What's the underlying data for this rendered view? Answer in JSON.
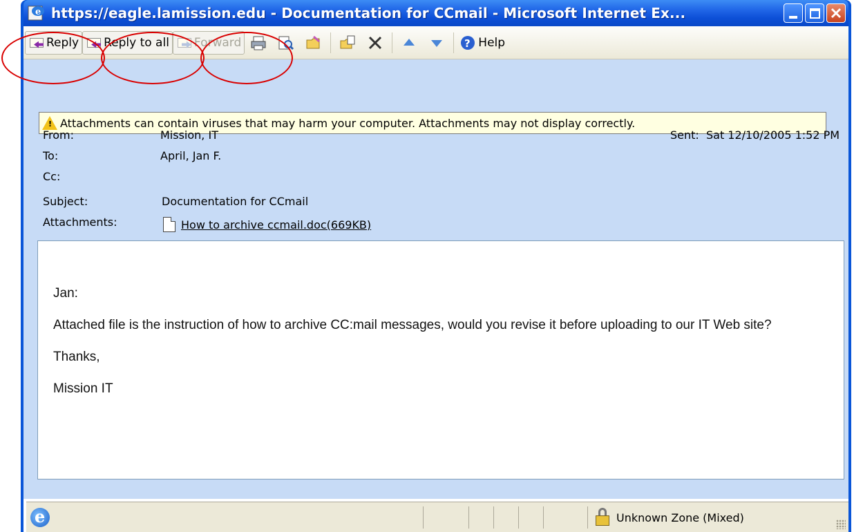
{
  "window": {
    "title": "https://eagle.lamission.edu - Documentation for CCmail - Microsoft Internet Ex..."
  },
  "toolbar": {
    "reply_label": "Reply",
    "reply_all_label": "Reply to all",
    "forward_label": "Forward",
    "help_label": "Help"
  },
  "warning": {
    "text": "Attachments can contain viruses that may harm your computer. Attachments may not display correctly."
  },
  "header": {
    "from_label": "From:",
    "from_value": "Mission, IT",
    "to_label": "To:",
    "to_value": "April, Jan F.",
    "cc_label": "Cc:",
    "cc_value": "",
    "subject_label": "Subject:",
    "subject_value": "Documentation for CCmail",
    "attachments_label": "Attachments:",
    "attachment_name": "How to archive ccmail.doc(669KB)",
    "sent_label": "Sent:",
    "sent_value": "Sat 12/10/2005 1:52 PM"
  },
  "body": {
    "greeting": "Jan:",
    "paragraph": "Attached file is the instruction of how to archive CC:mail messages, would you revise it before uploading to our IT Web site?",
    "closing": "Thanks,",
    "signature": "Mission IT"
  },
  "status": {
    "zone_text": "Unknown Zone (Mixed)"
  },
  "colors": {
    "annotation": "#d90000",
    "header_background": "#c7dbf6",
    "titlebar": "#0c4fd6"
  }
}
